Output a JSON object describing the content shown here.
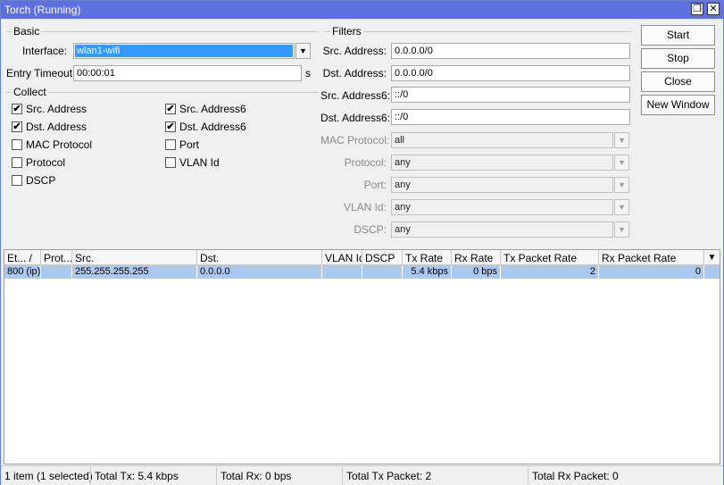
{
  "window": {
    "title": "Torch (Running)",
    "restore_glyph": "❐",
    "close_glyph": "✕"
  },
  "basic": {
    "group_label": "Basic",
    "interface_label": "Interface:",
    "interface_value": "wlan1-wifi",
    "entry_timeout_label": "Entry Timeout:",
    "entry_timeout_value": "00:00:01",
    "entry_timeout_unit": "s"
  },
  "collect": {
    "group_label": "Collect",
    "items": [
      {
        "label": "Src. Address",
        "checked": "✔"
      },
      {
        "label": "Dst. Address",
        "checked": "✔"
      },
      {
        "label": "MAC Protocol",
        "checked": ""
      },
      {
        "label": "Protocol",
        "checked": ""
      },
      {
        "label": "DSCP",
        "checked": ""
      },
      {
        "label": "Src. Address6",
        "checked": "✔"
      },
      {
        "label": "Dst. Address6",
        "checked": "✔"
      },
      {
        "label": "Port",
        "checked": ""
      },
      {
        "label": "VLAN Id",
        "checked": ""
      }
    ]
  },
  "filters": {
    "group_label": "Filters",
    "rows": [
      {
        "label": "Src. Address:",
        "value": "0.0.0.0/0"
      },
      {
        "label": "Dst. Address:",
        "value": "0.0.0.0/0"
      },
      {
        "label": "Src. Address6:",
        "value": "::/0"
      },
      {
        "label": "Dst. Address6:",
        "value": "::/0"
      },
      {
        "label": "MAC Protocol:",
        "value": "all"
      },
      {
        "label": "Protocol:",
        "value": "any"
      },
      {
        "label": "Port:",
        "value": "any"
      },
      {
        "label": "VLAN Id:",
        "value": "any"
      },
      {
        "label": "DSCP:",
        "value": "any"
      }
    ]
  },
  "buttons": {
    "start": "Start",
    "stop": "Stop",
    "close": "Close",
    "new_window": "New Window"
  },
  "table": {
    "columns": [
      "Et... /",
      "Prot...",
      "Src.",
      "Dst.",
      "VLAN Id",
      "DSCP",
      "Tx Rate",
      "Rx Rate",
      "Tx Packet Rate",
      "Rx Packet Rate"
    ],
    "menu_glyph": "▼",
    "rows": [
      {
        "eth": "800 (ip)",
        "proto": "",
        "src": "255.255.255.255",
        "dst": "0.0.0.0",
        "vlan": "",
        "dscp": "",
        "tx_rate": "5.4 kbps",
        "rx_rate": "0 bps",
        "tx_packet_rate": "2",
        "rx_packet_rate": "0"
      }
    ]
  },
  "status": {
    "items": "1 item (1 selected)",
    "total_tx": "Total Tx: 5.4 kbps",
    "total_rx": "Total Rx: 0 bps",
    "total_tx_packet": "Total Tx Packet: 2",
    "total_rx_packet": "Total Rx Packet: 0"
  }
}
